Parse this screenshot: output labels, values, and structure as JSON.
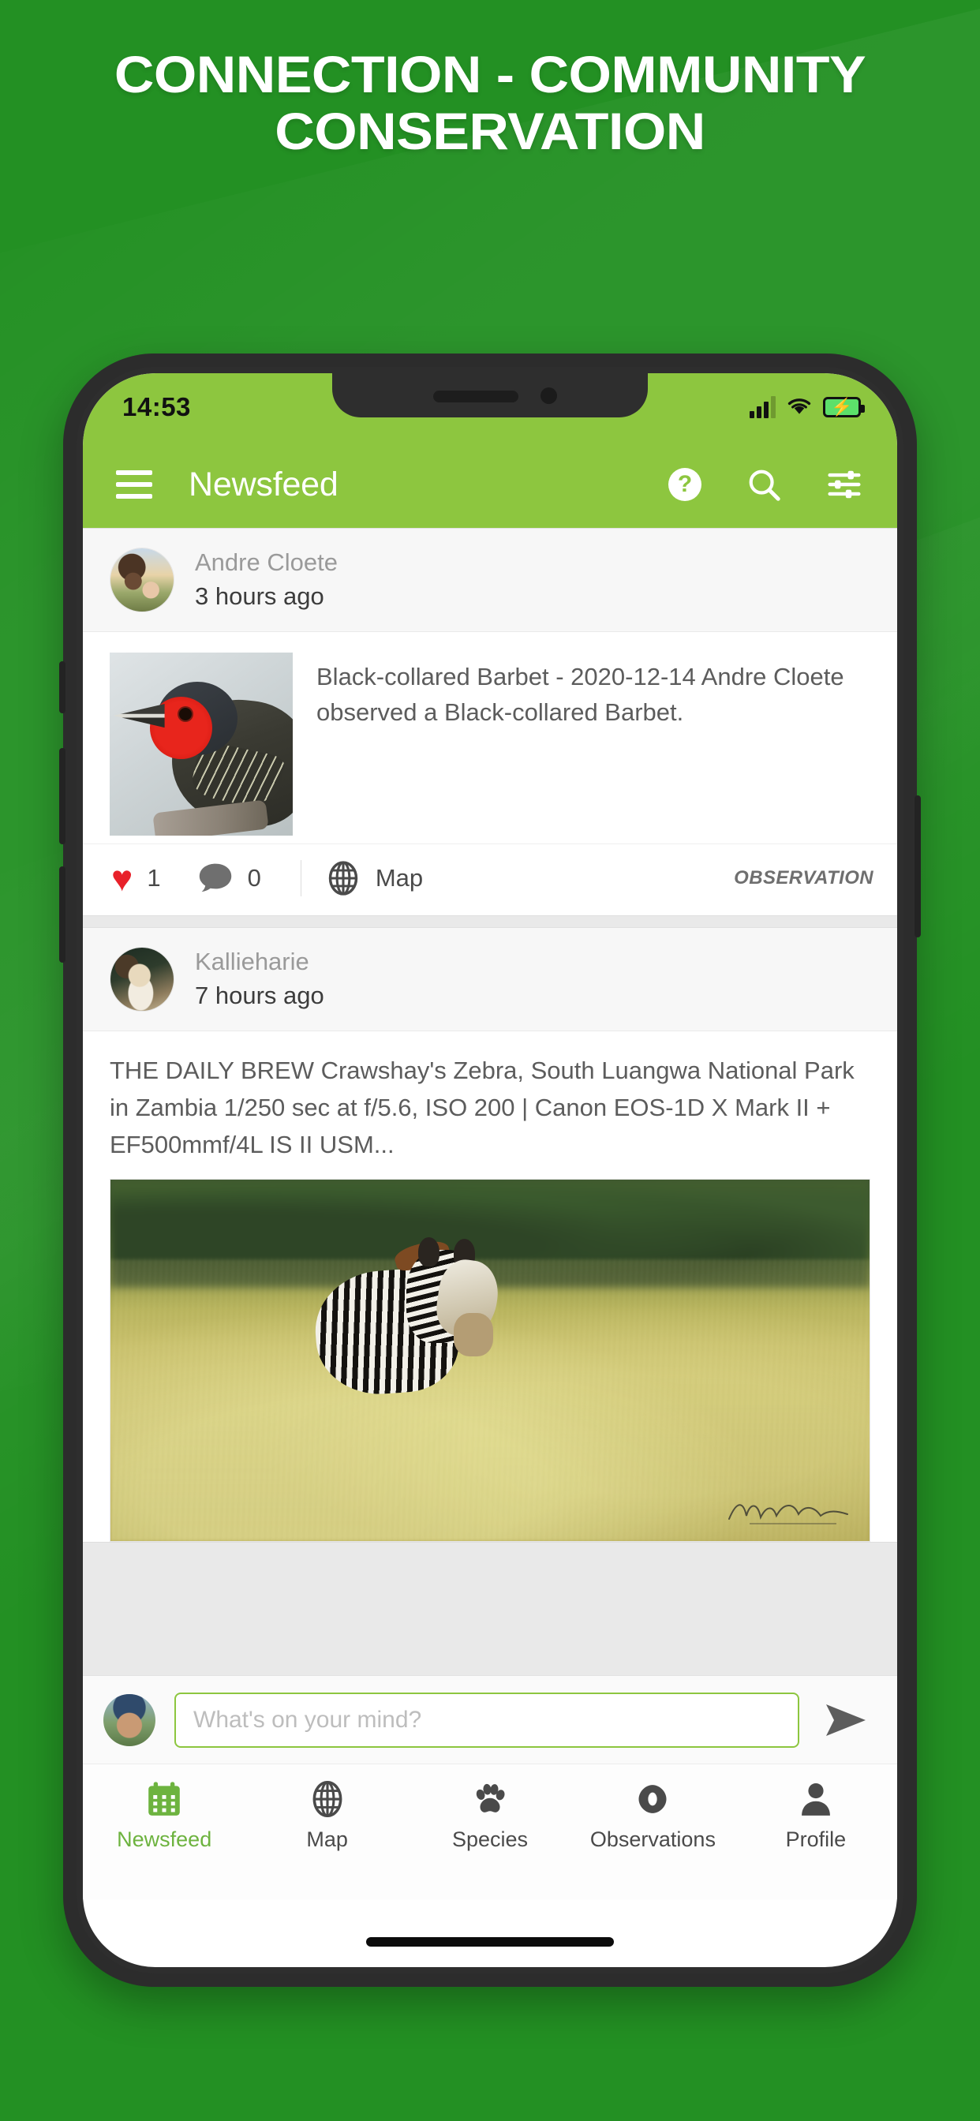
{
  "banner": {
    "line1": "CONNECTION - COMMUNITY",
    "line2": "CONSERVATION",
    "background_color": "#239023",
    "text_color": "#FFFFFF"
  },
  "phone": {
    "status_bar": {
      "time": "14:53",
      "signal_icon": "signal-bars-icon",
      "wifi_icon": "wifi-icon",
      "battery_icon": "battery-charging-icon",
      "background_color": "#8DC63F"
    },
    "home_indicator": true
  },
  "appbar": {
    "menu_icon": "hamburger-menu-icon",
    "title": "Newsfeed",
    "help_label": "?",
    "help_icon": "help-circle-icon",
    "search_icon": "search-icon",
    "filter_icon": "tune-sliders-icon",
    "background_color": "#8DC63F"
  },
  "feed": {
    "posts": [
      {
        "author": "Andre Cloete",
        "time": "3 hours ago",
        "avatar": "andre-avatar",
        "text": "Black-collared Barbet - 2020-12-14 Andre Cloete observed a Black-collared Barbet.",
        "thumbnail": "black-collared-barbet-photo",
        "likes": "1",
        "comments": "0",
        "map_label": "Map",
        "tag": "OBSERVATION",
        "like_icon": "heart-icon",
        "comment_icon": "comment-bubble-icon",
        "map_icon": "globe-icon",
        "like_color": "#E8212A"
      },
      {
        "author": "Kallieharie",
        "time": "7 hours ago",
        "avatar": "kallieharie-avatar",
        "text": "THE DAILY BREW Crawshay's Zebra, South Luangwa National Park in Zambia 1/250 sec at f/5.6, ISO 200 | Canon EOS-1D X Mark II + EF500mmf/4L IS II USM...",
        "image": "crawshays-zebra-photo"
      }
    ]
  },
  "composer": {
    "avatar": "current-user-avatar",
    "placeholder": "What's on your mind?",
    "value": "",
    "send_icon": "send-arrow-icon",
    "border_color": "#8DC63F"
  },
  "bottom_nav": {
    "active_color": "#6DB33F",
    "items": [
      {
        "label": "Newsfeed",
        "icon": "calendar-icon",
        "active": true
      },
      {
        "label": "Map",
        "icon": "globe-icon",
        "active": false
      },
      {
        "label": "Species",
        "icon": "paw-print-icon",
        "active": false
      },
      {
        "label": "Observations",
        "icon": "eye-icon",
        "active": false
      },
      {
        "label": "Profile",
        "icon": "person-icon",
        "active": false
      }
    ]
  }
}
